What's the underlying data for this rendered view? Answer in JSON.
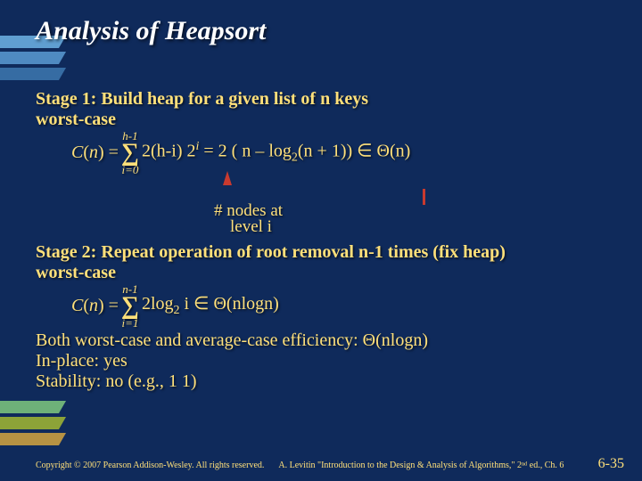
{
  "title": "Analysis of Heapsort",
  "stage1": {
    "heading": "Stage 1: Build heap for a given list of n keys",
    "worst": "worst-case",
    "cn": "C(n) = ",
    "sum_upper": "h-1",
    "sum_lower": "i=0",
    "sum_body_a": " 2(h-i) 2",
    "sum_body_b": "   =   2 ( n – log",
    "sum_body_c": "(n + 1))  ∈ Θ(n)",
    "note1": "# nodes at",
    "note2": "level i"
  },
  "stage2": {
    "heading": "Stage 2: Repeat operation of root removal n-1 times (fix heap)",
    "worst": "worst-case",
    "cn": "C(n) = ",
    "sum_upper": "n-1",
    "sum_lower": "i=1",
    "sum_body_a": " 2log",
    "sum_body_b": " i ∈ Θ(nlogn)"
  },
  "tail": {
    "both": "Both worst-case and average-case efficiency: Θ(nlogn)",
    "inplace": "In-place: yes",
    "stability": "Stability: no (e.g., 1  1)"
  },
  "footer": {
    "copyright": "Copyright © 2007 Pearson Addison-Wesley. All rights reserved.",
    "cite": "A. Levitin \"Introduction to the Design & Analysis of Algorithms,\" 2ⁿᵈ ed., Ch. 6",
    "page": "6-35"
  }
}
